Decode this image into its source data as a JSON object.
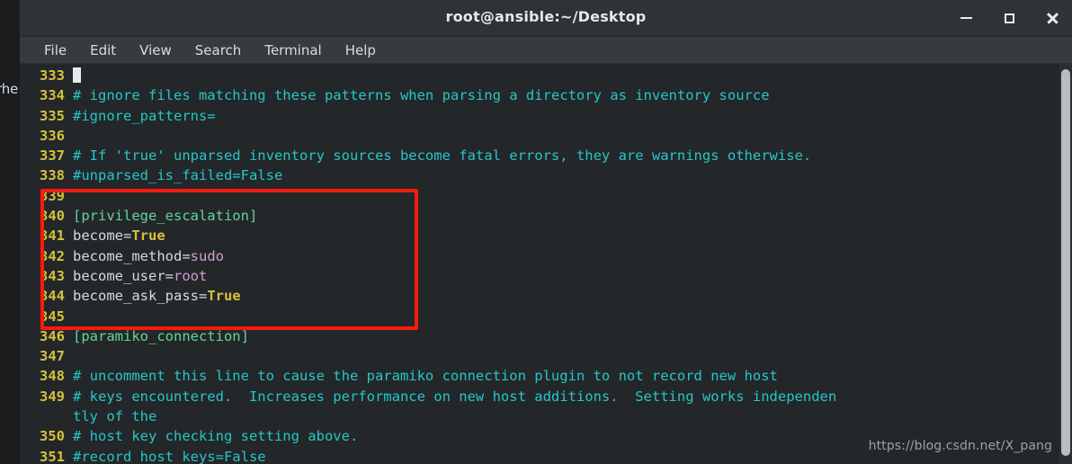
{
  "background_window": {
    "partial_text": "rhe"
  },
  "window": {
    "title": "root@ansible:~/Desktop",
    "controls": {
      "minimize_label": "Minimize",
      "maximize_label": "Maximize",
      "close_label": "Close"
    }
  },
  "menubar": {
    "items": [
      {
        "label": "File"
      },
      {
        "label": "Edit"
      },
      {
        "label": "View"
      },
      {
        "label": "Search"
      },
      {
        "label": "Terminal"
      },
      {
        "label": "Help"
      }
    ]
  },
  "terminal": {
    "lines": [
      {
        "number": "333",
        "segments": []
      },
      {
        "number": "334",
        "segments": [
          {
            "type": "comment",
            "text": "# ignore files matching these patterns when parsing a directory as inventory source"
          }
        ]
      },
      {
        "number": "335",
        "segments": [
          {
            "type": "comment",
            "text": "#ignore_patterns="
          }
        ]
      },
      {
        "number": "336",
        "segments": []
      },
      {
        "number": "337",
        "segments": [
          {
            "type": "comment",
            "text": "# If 'true' unparsed inventory sources become fatal errors, they are warnings otherwise."
          }
        ]
      },
      {
        "number": "338",
        "segments": [
          {
            "type": "comment",
            "text": "#unparsed_is_failed=False"
          }
        ]
      },
      {
        "number": "339",
        "segments": []
      },
      {
        "number": "340",
        "segments": [
          {
            "type": "section",
            "text": "[privilege_escalation]"
          }
        ]
      },
      {
        "number": "341",
        "segments": [
          {
            "type": "key",
            "text": "become="
          },
          {
            "type": "bool",
            "text": "True"
          }
        ]
      },
      {
        "number": "342",
        "segments": [
          {
            "type": "key",
            "text": "become_method="
          },
          {
            "type": "val",
            "text": "sudo"
          }
        ]
      },
      {
        "number": "343",
        "segments": [
          {
            "type": "key",
            "text": "become_user="
          },
          {
            "type": "val",
            "text": "root"
          }
        ]
      },
      {
        "number": "344",
        "segments": [
          {
            "type": "key",
            "text": "become_ask_pass="
          },
          {
            "type": "bool",
            "text": "True"
          }
        ]
      },
      {
        "number": "345",
        "segments": []
      },
      {
        "number": "346",
        "segments": [
          {
            "type": "section",
            "text": "[paramiko_connection]"
          }
        ]
      },
      {
        "number": "347",
        "segments": []
      },
      {
        "number": "348",
        "segments": [
          {
            "type": "comment",
            "text": "# uncomment this line to cause the paramiko connection plugin to not record new host"
          }
        ]
      },
      {
        "number": "349",
        "segments": [
          {
            "type": "comment",
            "text": "# keys encountered.  Increases performance on new host additions.  Setting works independen"
          }
        ],
        "continuation": "tly of the"
      },
      {
        "number": "350",
        "segments": [
          {
            "type": "comment",
            "text": "# host key checking setting above."
          }
        ]
      },
      {
        "number": "351",
        "segments": [
          {
            "type": "comment",
            "text": "#record_host_keys=False"
          }
        ]
      }
    ],
    "cursor_on_line": "333"
  },
  "annotation": {
    "type": "red-rectangle",
    "color": "#f61b0d",
    "highlights_lines": [
      "339",
      "340",
      "341",
      "342",
      "343",
      "344",
      "345"
    ]
  },
  "scrollbar": {
    "orientation": "vertical"
  },
  "watermark": {
    "text": "https://blog.csdn.net/X_pang"
  },
  "colors": {
    "background": "#23272a",
    "titlebar": "#2e3336",
    "menubar": "#353b3e",
    "line_number": "#d4c23a",
    "comment": "#27c6c6",
    "section": "#64d69a",
    "key": "#d6dade",
    "boolean": "#d4c23a",
    "value": "#cf9fc9",
    "annotation": "#f61b0d",
    "scrollbar_thumb": "#b9bdbf"
  }
}
